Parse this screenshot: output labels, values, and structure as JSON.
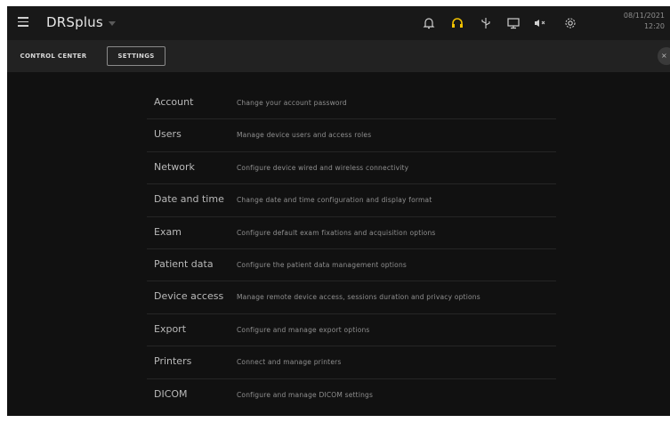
{
  "header": {
    "app_title": "DRSplus",
    "date": "08/11/2021",
    "time": "12:20",
    "icons": [
      "menu-icon",
      "bell-icon",
      "headset-icon",
      "usb-icon",
      "monitor-icon",
      "speaker-muted-icon",
      "gear-icon"
    ],
    "headset_color": "#f2c200"
  },
  "tabs": [
    {
      "label": "CONTROL CENTER"
    },
    {
      "label": "SETTINGS"
    }
  ],
  "close_label": "×",
  "settings": [
    {
      "label": "Account",
      "description": "Change your account password"
    },
    {
      "label": "Users",
      "description": "Manage device users and access roles"
    },
    {
      "label": "Network",
      "description": "Configure device wired and wireless connectivity"
    },
    {
      "label": "Date and time",
      "description": "Change date and time configuration and display format"
    },
    {
      "label": "Exam",
      "description": "Configure default exam fixations and acquisition options"
    },
    {
      "label": "Patient data",
      "description": "Configure the patient data management options"
    },
    {
      "label": "Device access",
      "description": "Manage remote device access, sessions duration and privacy options"
    },
    {
      "label": "Export",
      "description": "Configure and manage export options"
    },
    {
      "label": "Printers",
      "description": "Connect and manage printers"
    },
    {
      "label": "DICOM",
      "description": "Configure and manage DICOM settings"
    }
  ]
}
